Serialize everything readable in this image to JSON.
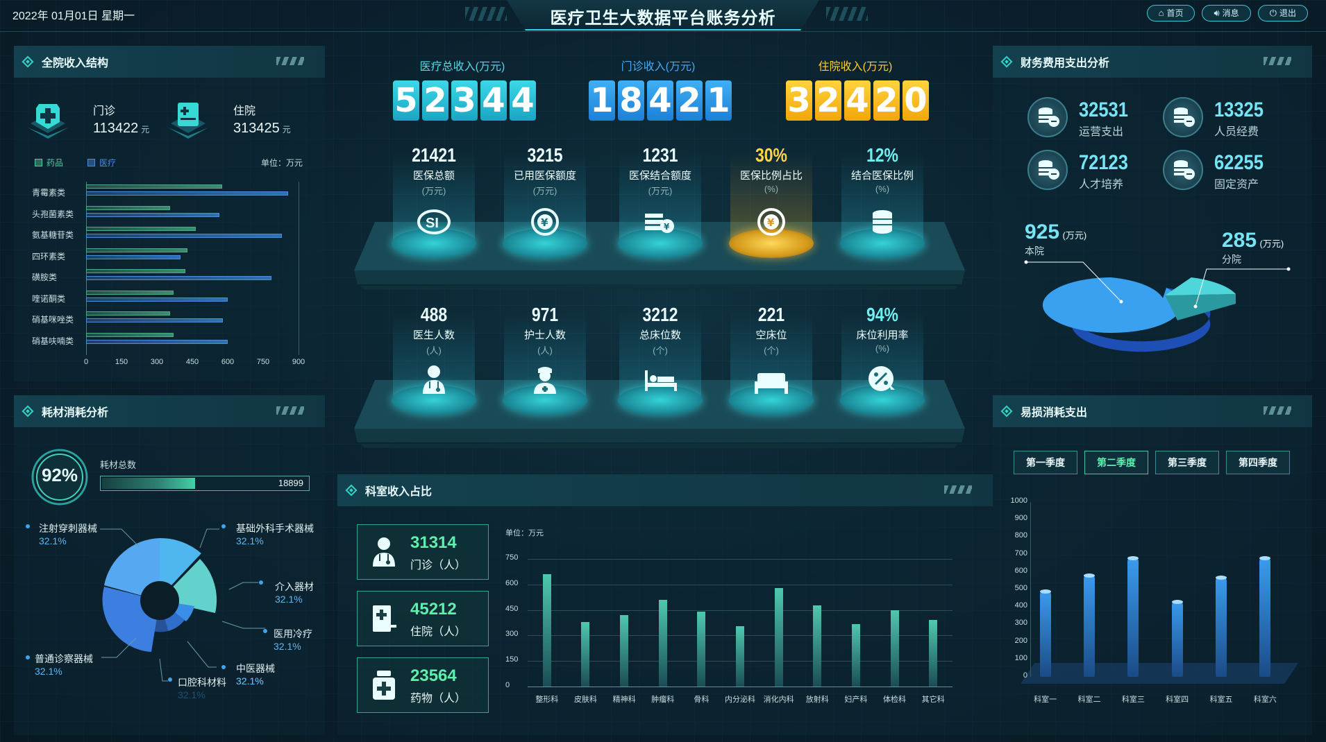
{
  "header": {
    "date": "2022年 01月01日   星期一",
    "title": "医疗卫生大数据平台账务分析",
    "buttons": [
      {
        "label": "首页",
        "icon": "home-icon"
      },
      {
        "label": "消息",
        "icon": "speaker-icon"
      },
      {
        "label": "退出",
        "icon": "power-icon"
      }
    ]
  },
  "income_structure": {
    "title": "全院收入结构",
    "outpatient": {
      "label": "门诊",
      "value": "113422",
      "unit": "元"
    },
    "inpatient": {
      "label": "住院",
      "value": "313425",
      "unit": "元"
    },
    "legend": [
      "药品",
      "医疗"
    ],
    "unit_label": "单位：万元",
    "chart_data": {
      "type": "bar",
      "orientation": "horizontal",
      "categories": [
        "青霉素类",
        "头孢菌素类",
        "氨基糖苷类",
        "四环素类",
        "磺胺类",
        "喹诺酮类",
        "硝基咪唑类",
        "硝基呋喃类"
      ],
      "series": [
        {
          "name": "药品",
          "values": [
            575,
            355,
            465,
            430,
            420,
            370,
            355,
            370
          ]
        },
        {
          "name": "医疗",
          "values": [
            855,
            565,
            830,
            400,
            785,
            600,
            580,
            600
          ]
        }
      ],
      "xticks": [
        "0",
        "150",
        "300",
        "450",
        "600",
        "750",
        "900"
      ],
      "xlim": [
        0,
        900
      ]
    }
  },
  "consumables": {
    "title": "耗材消耗分析",
    "percent": "92%",
    "total_label": "耗材总数",
    "total_value": "18899",
    "progress": 0.45,
    "slices": [
      {
        "name": "注射穿刺器械",
        "pct": "32.1%"
      },
      {
        "name": "基础外科手术器械",
        "pct": "32.1%"
      },
      {
        "name": "介入器材",
        "pct": "32.1%"
      },
      {
        "name": "医用冷疗",
        "pct": "32.1%"
      },
      {
        "name": "中医器械",
        "pct": "32.1%"
      },
      {
        "name": "口腔科材料",
        "pct": "32.1%"
      },
      {
        "name": "普通诊察器械",
        "pct": "32.1%"
      }
    ],
    "extra_pct": "32.1%"
  },
  "totals": {
    "total_income": {
      "label": "医疗总收入(万元)",
      "digits": [
        "5",
        "2",
        "3",
        "4",
        "4"
      ]
    },
    "outpatient_income": {
      "label": "门诊收入(万元)",
      "digits": [
        "1",
        "8",
        "4",
        "2",
        "1"
      ]
    },
    "inpatient_income": {
      "label": "住院收入(万元)",
      "digits": [
        "3",
        "2",
        "4",
        "2",
        "0"
      ]
    }
  },
  "stats_row1": [
    {
      "value": "21421",
      "label": "医保总额",
      "unit": "(万元)",
      "icon": "si-logo-icon"
    },
    {
      "value": "3215",
      "label": "已用医保额度",
      "unit": "(万元)",
      "icon": "yen-coin-icon"
    },
    {
      "value": "1231",
      "label": "医保结合额度",
      "unit": "(万元)",
      "icon": "money-stack-icon"
    },
    {
      "value": "30%",
      "label": "医保比例占比",
      "unit": "(%)",
      "icon": "yen-target-icon"
    },
    {
      "value": "12%",
      "label": "结合医保比例",
      "unit": "(%)",
      "icon": "coins-icon"
    }
  ],
  "stats_row2": [
    {
      "value": "488",
      "label": "医生人数",
      "unit": "(人)",
      "icon": "doctor-icon"
    },
    {
      "value": "971",
      "label": "护士人数",
      "unit": "(人)",
      "icon": "nurse-icon"
    },
    {
      "value": "3212",
      "label": "总床位数",
      "unit": "(个)",
      "icon": "bed-icon"
    },
    {
      "value": "221",
      "label": "空床位",
      "unit": "(个)",
      "icon": "empty-bed-icon"
    },
    {
      "value": "94%",
      "label": "床位利用率",
      "unit": "(%)",
      "icon": "percent-icon"
    }
  ],
  "department": {
    "title": "科室收入占比",
    "cards": [
      {
        "value": "31314",
        "label": "门诊（人）",
        "icon": "doctor-icon"
      },
      {
        "value": "45212",
        "label": "住院（人）",
        "icon": "clipboard-icon"
      },
      {
        "value": "23564",
        "label": "药物（人）",
        "icon": "medicine-icon"
      }
    ],
    "unit_label": "单位：万元",
    "chart_data": {
      "type": "bar",
      "categories": [
        "整形科",
        "皮肤科",
        "精神科",
        "肿瘤科",
        "骨科",
        "内分泌科",
        "消化内科",
        "放射科",
        "妇产科",
        "体检科",
        "其它科"
      ],
      "values": [
        660,
        380,
        420,
        510,
        440,
        355,
        580,
        475,
        365,
        450,
        390
      ],
      "yticks": [
        "0",
        "150",
        "300",
        "450",
        "600",
        "750"
      ],
      "ylim": [
        0,
        750
      ]
    }
  },
  "finance": {
    "title": "财务费用支出分析",
    "items": [
      {
        "value": "32531",
        "label": "运营支出",
        "icon": "coin-stack-icon"
      },
      {
        "value": "13325",
        "label": "人员经费",
        "icon": "coin-stack-icon"
      },
      {
        "value": "72123",
        "label": "人才培养",
        "icon": "coin-stack-icon"
      },
      {
        "value": "62255",
        "label": "固定资产",
        "icon": "coin-stack-icon"
      }
    ],
    "chart_data": {
      "type": "pie",
      "slices": [
        {
          "name": "本院",
          "value": 925,
          "unit": "(万元)"
        },
        {
          "name": "分院",
          "value": 285,
          "unit": "(万元)"
        }
      ]
    }
  },
  "perishables": {
    "title": "易损消耗支出",
    "quarters": [
      "第一季度",
      "第二季度",
      "第三季度",
      "第四季度"
    ],
    "active_quarter": 1,
    "chart_data": {
      "type": "bar",
      "categories": [
        "科室一",
        "科室二",
        "科室三",
        "科室四",
        "科室五",
        "科室六"
      ],
      "values": [
        500,
        590,
        690,
        440,
        580,
        690
      ],
      "yticks": [
        "0",
        "100",
        "200",
        "300",
        "400",
        "500",
        "600",
        "700",
        "800",
        "900",
        "1000"
      ],
      "ylim": [
        0,
        1000
      ]
    }
  }
}
